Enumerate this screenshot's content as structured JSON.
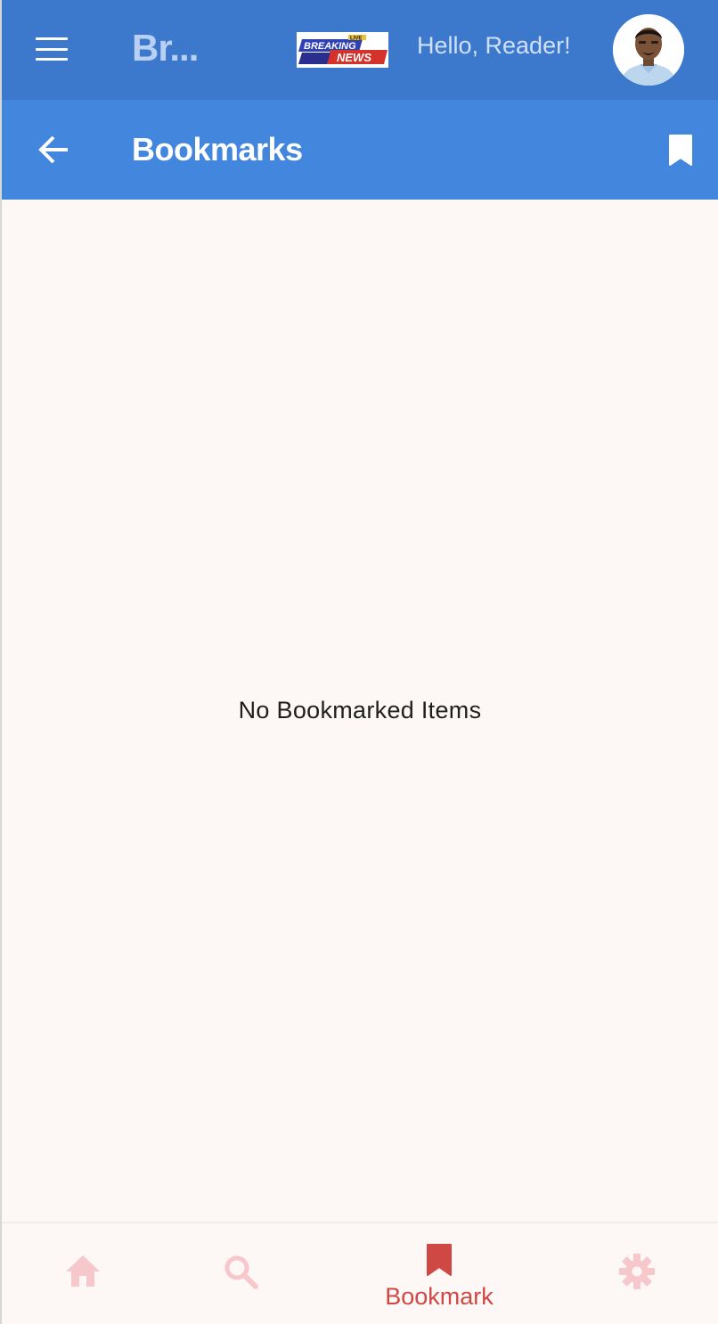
{
  "header": {
    "app_title": "Br...",
    "logo": {
      "top_text": "LIVE",
      "line1": "BREAKING",
      "line2": "NEWS"
    },
    "greeting": "Hello, Reader!",
    "menu_icon": "hamburger-menu-icon",
    "avatar_icon": "user-avatar-photo"
  },
  "subheader": {
    "title": "Bookmarks",
    "back_icon": "arrow-left-icon",
    "action_icon": "bookmark-icon"
  },
  "main": {
    "empty_message": "No Bookmarked Items"
  },
  "bottom_nav": {
    "items": [
      {
        "icon": "home-icon",
        "label": "",
        "active": false
      },
      {
        "icon": "search-icon",
        "label": "",
        "active": false
      },
      {
        "icon": "bookmark-icon",
        "label": "Bookmark",
        "active": true
      },
      {
        "icon": "gear-icon",
        "label": "",
        "active": false
      }
    ]
  },
  "colors": {
    "topbar": "#3c78cc",
    "subbar": "#4287dd",
    "background": "#fdf7f6",
    "nav_active": "#d04844",
    "nav_inactive": "#f6c8cb"
  }
}
